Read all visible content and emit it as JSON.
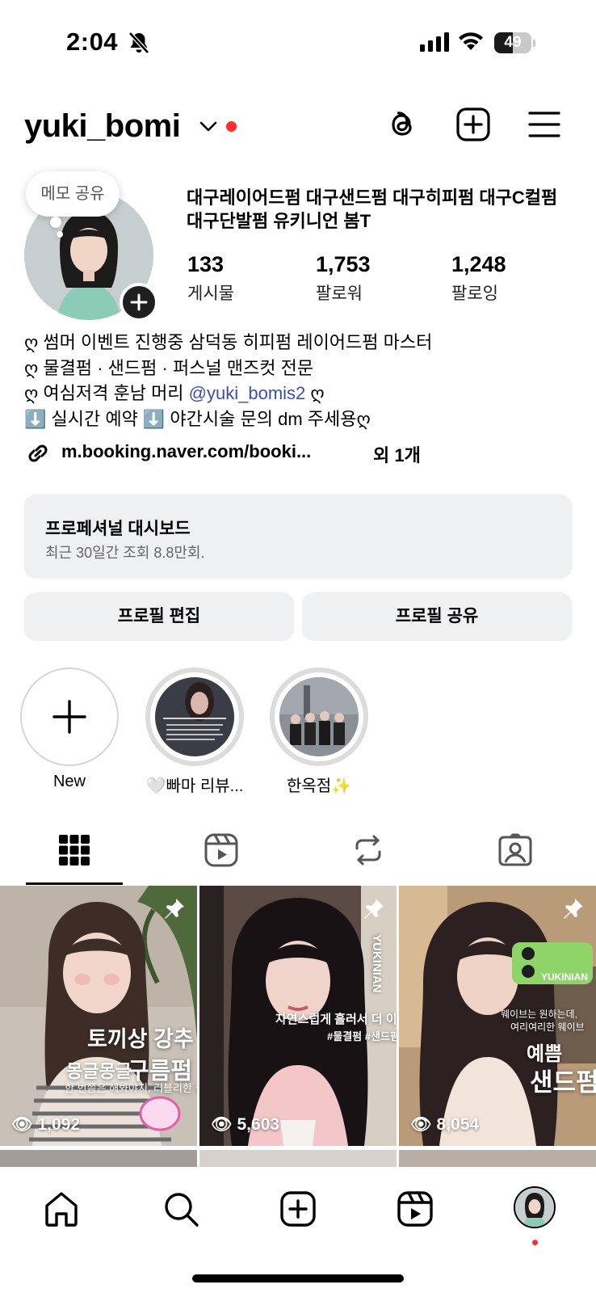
{
  "status_bar": {
    "time": "2:04",
    "battery": "49",
    "battery_level": 0.49
  },
  "header": {
    "username": "yuki_bomi"
  },
  "note": {
    "text": "메모 공유"
  },
  "profile": {
    "category": "대구레이어드펌 대구샌드펌 대구히피펌 대구C컬펌 대구단발펌 유키니언 봄T",
    "stats": [
      {
        "value": "133",
        "label": "게시물"
      },
      {
        "value": "1,753",
        "label": "팔로워"
      },
      {
        "value": "1,248",
        "label": "팔로잉"
      }
    ],
    "bio": {
      "line1": "ღ  썸머 이벤트 진행중 삼덕동 히피펌 레이어드펌 마스터",
      "line2": "ღ  물결펌 · 샌드펌 · 퍼스널 맨즈컷 전문",
      "line3_prefix": "ღ  여심저격 훈남 머리 ",
      "line3_mention": "@yuki_bomis2",
      "line3_suffix": " ღ",
      "line4": "⬇️ 실시간 예약 ⬇️ 야간시술 문의 dm  주세용ღ"
    },
    "link": {
      "text": "m.booking.naver.com/booki...",
      "more": "외 1개"
    }
  },
  "dashboard": {
    "title": "프로페셔널 대시보드",
    "subtitle": "최근 30일간 조회 8.8만회."
  },
  "buttons": {
    "edit": "프로필 편집",
    "share": "프로필 공유"
  },
  "highlights": [
    {
      "label": "New"
    },
    {
      "label": "🤍빠마 리뷰..."
    },
    {
      "label": "한옥점✨"
    }
  ],
  "posts": [
    {
      "views": "1,092",
      "line1": "토끼상 강추",
      "line2a": "몽글몽글",
      "line2b": "구름펌",
      "line3": "한 번쯤은 해봐야지, 러블리한 펌"
    },
    {
      "views": "5,603",
      "line1": "자연스럽게 흘러서 더 이쁜",
      "line2": "#물결펌 #샌드펌",
      "brand": "YUKINIAN"
    },
    {
      "views": "8,054",
      "line1": "웨이브는 원하는데,",
      "line2": "여리여리한 웨이브",
      "line3": "예쁨",
      "line4": "샌드펌",
      "brand": "YUKINIAN"
    }
  ],
  "colors": {
    "accent_red": "#ff2e2e",
    "mention_blue": "#3b4fb0",
    "button_bg": "#eff0f2"
  }
}
